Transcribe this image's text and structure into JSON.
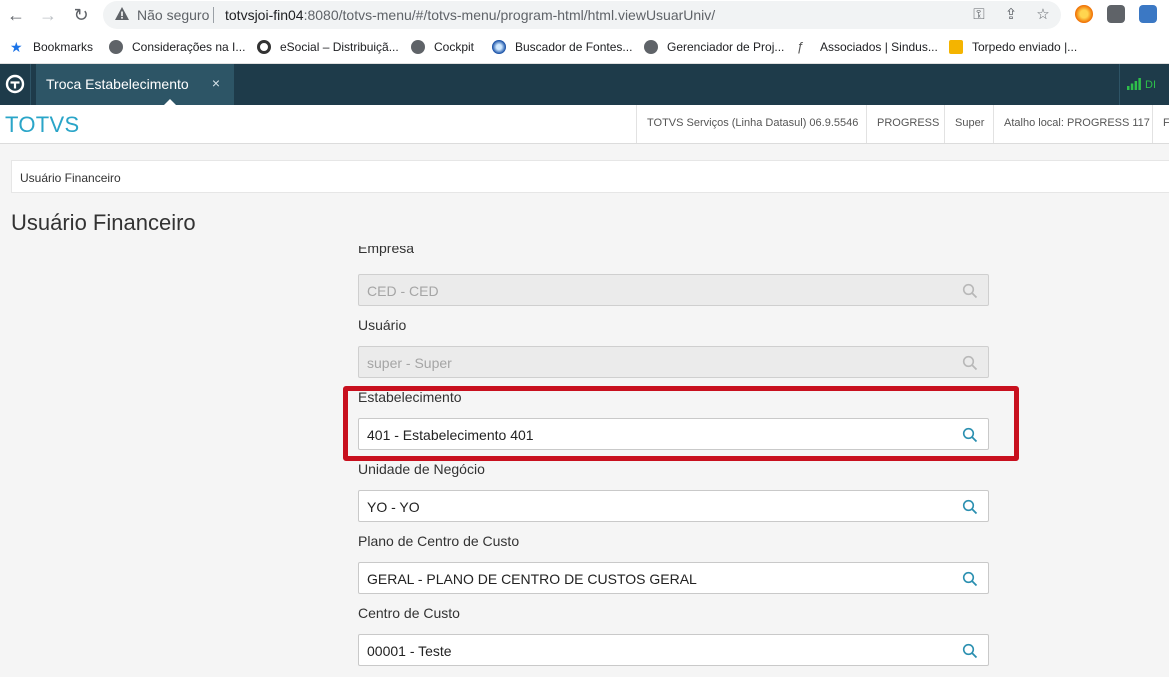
{
  "browser": {
    "security_label": "Não seguro",
    "url_host": "totvsjoi-fin04",
    "url_rest": ":8080/totvs-menu/#/totvs-menu/program-html/html.viewUsuarUniv/"
  },
  "bookmarks": [
    {
      "label": "Bookmarks",
      "icon": "star-icon"
    },
    {
      "label": "Considerações na I...",
      "icon": "globe-icon"
    },
    {
      "label": "eSocial – Distribuiçã...",
      "icon": "totvs-icon"
    },
    {
      "label": "Cockpit",
      "icon": "globe-icon"
    },
    {
      "label": "Buscador de Fontes...",
      "icon": "blue-circle-icon"
    },
    {
      "label": "Gerenciador de Proj...",
      "icon": "globe-icon"
    },
    {
      "label": "Associados | Sindus...",
      "icon": "sindus-icon"
    },
    {
      "label": "Torpedo enviado |...",
      "icon": "yellow-doc-icon"
    }
  ],
  "app": {
    "tab_label": "Troca Estabelecimento",
    "tab_close": "×",
    "signal_text": "DI",
    "brand": "TOTVS",
    "info": {
      "product": "TOTVS Serviços (Linha Datasul) 06.9.5546",
      "db": "PROGRESS",
      "user": "Super",
      "shortcut": "Atalho local: PROGRESS 117",
      "extra": "F"
    }
  },
  "page": {
    "breadcrumb": "Usuário Financeiro",
    "title": "Usuário Financeiro"
  },
  "form": {
    "empresa": {
      "label": "Empresa",
      "value": "CED - CED",
      "disabled": true
    },
    "usuario": {
      "label": "Usuário",
      "value": "super - Super",
      "disabled": true
    },
    "estabelecimento": {
      "label": "Estabelecimento",
      "value": "401 - Estabelecimento 401",
      "disabled": false
    },
    "unidade": {
      "label": "Unidade de Negócio",
      "value": "YO - YO",
      "disabled": false
    },
    "plano": {
      "label": "Plano de Centro de Custo",
      "value": "GERAL - PLANO DE CENTRO DE CUSTOS GERAL",
      "disabled": false
    },
    "centro": {
      "label": "Centro de Custo",
      "value": "00001 - Teste",
      "disabled": false
    }
  },
  "colors": {
    "header": "#1e3b4a",
    "brand": "#2aa5c8",
    "highlight": "#c8101e",
    "search_icon": "#2a8fb0"
  }
}
